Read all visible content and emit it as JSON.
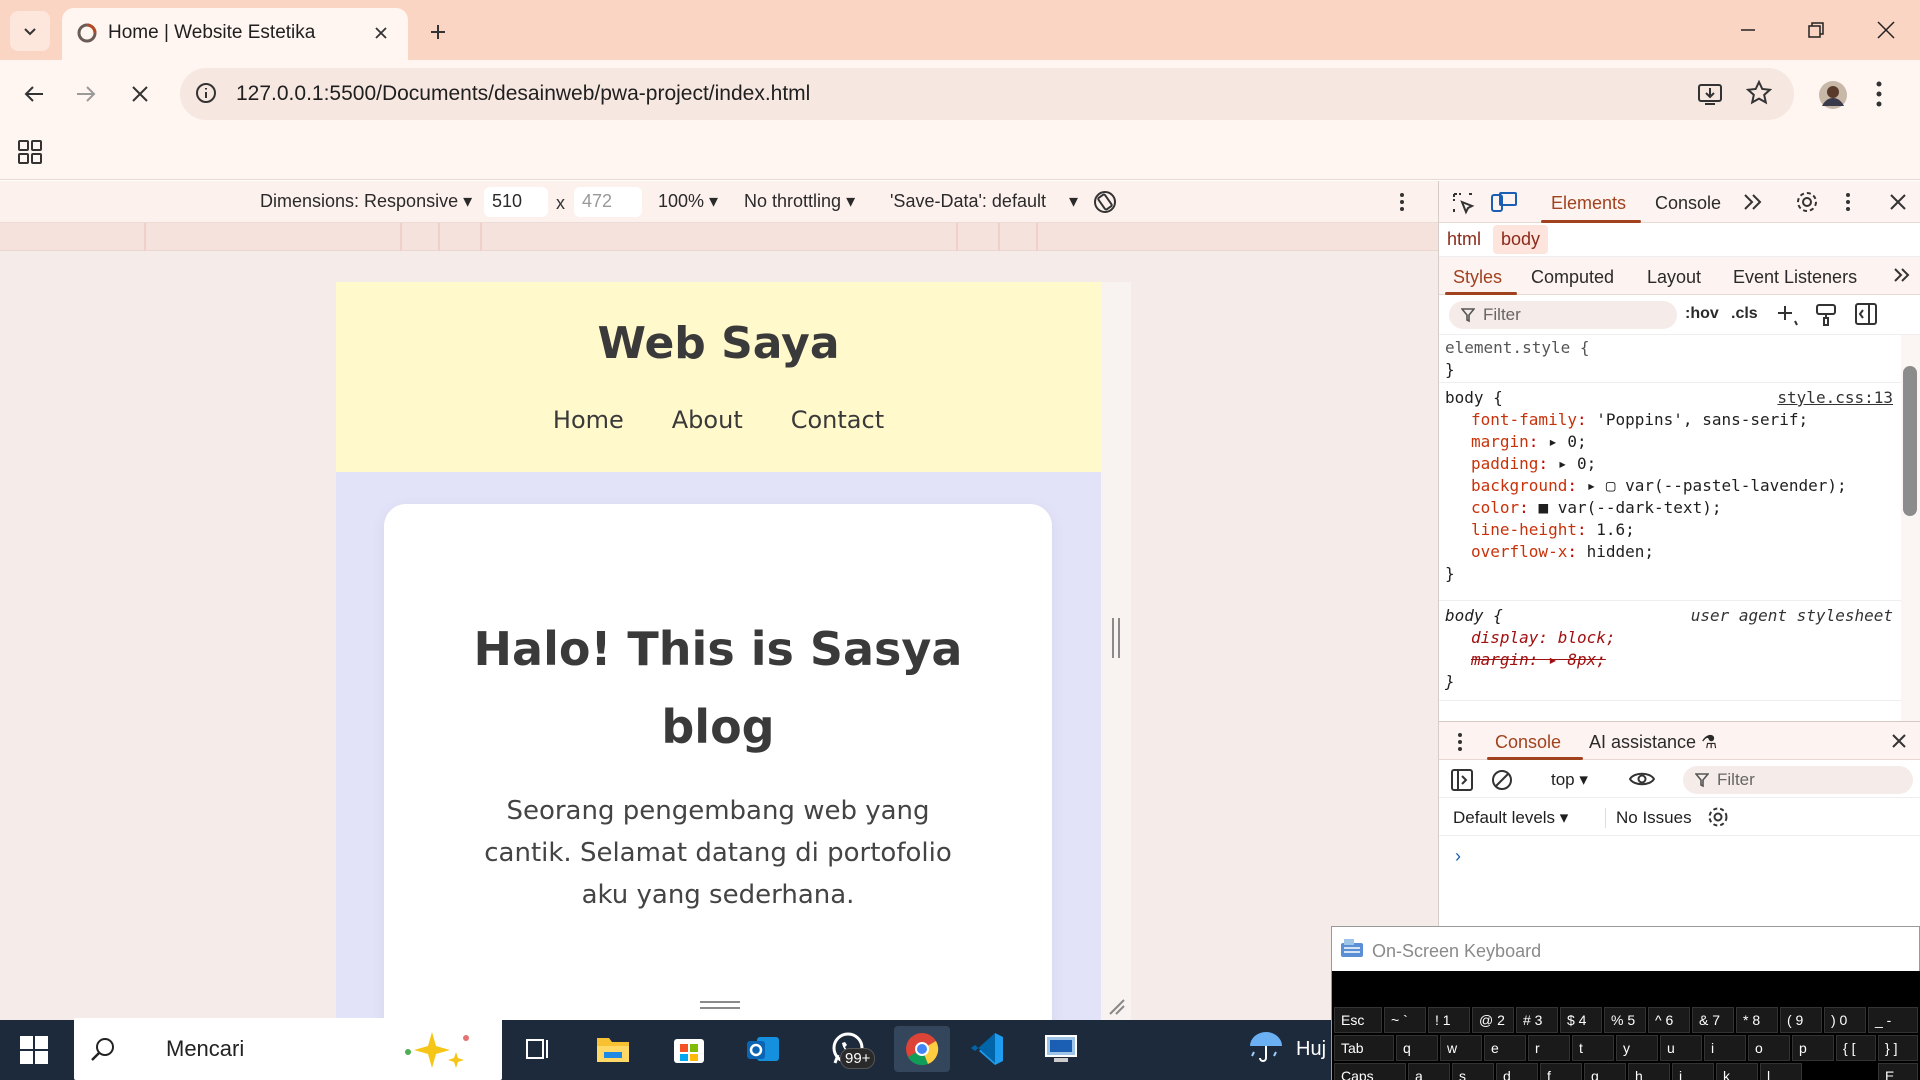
{
  "browser": {
    "tab_title": "Home | Website Estetika",
    "url": "127.0.0.1:5500/Documents/desainweb/pwa-project/index.html"
  },
  "device_toolbar": {
    "dimensions_label": "Dimensions: Responsive",
    "width_value": "510",
    "height_placeholder": "472",
    "times": "x",
    "zoom": "100%",
    "throttling": "No throttling",
    "save_data": "'Save-Data': default"
  },
  "site": {
    "title": "Web Saya",
    "nav": [
      "Home",
      "About",
      "Contact"
    ],
    "hero_title": "Halo! This is Sasya blog",
    "hero_text": "Seorang pengembang web yang cantik. Selamat datang di portofolio aku yang sederhana."
  },
  "devtools": {
    "tabs": {
      "elements": "Elements",
      "console": "Console"
    },
    "breadcrumb": {
      "html": "html",
      "body": "body"
    },
    "styles_tabs": [
      "Styles",
      "Computed",
      "Layout",
      "Event Listeners"
    ],
    "filter_placeholder": "Filter",
    "hov": ":hov",
    "cls": ".cls",
    "rules": {
      "element_style": "element.style {",
      "close": "}",
      "body_selector": "body {",
      "body_source": "style.css:13",
      "body_props": [
        {
          "name": "font-family",
          "value": "'Poppins', sans-serif;"
        },
        {
          "name": "margin",
          "value": "▸ 0;"
        },
        {
          "name": "padding",
          "value": "▸ 0;"
        },
        {
          "name": "background",
          "value": "▸ ▢ var(--pastel-lavender);"
        },
        {
          "name": "color",
          "value": "■ var(--dark-text);"
        },
        {
          "name": "line-height",
          "value": "1.6;"
        },
        {
          "name": "overflow-x",
          "value": "hidden;"
        }
      ],
      "ua_selector": "body {",
      "ua_source": "user agent stylesheet",
      "ua_display": "display: block;",
      "ua_margin": "margin: ▸ 8px;"
    },
    "console": {
      "tab": "Console",
      "ai_tab": "AI assistance",
      "context": "top",
      "filter_placeholder": "Filter",
      "levels": "Default levels",
      "issues": "No Issues",
      "prompt": "›"
    }
  },
  "osk": {
    "title": "On-Screen Keyboard",
    "row1": [
      "Esc",
      "~ `",
      "! 1",
      "@ 2",
      "# 3",
      "$ 4",
      "% 5",
      "^ 6",
      "& 7",
      "* 8",
      "( 9",
      ") 0",
      "_ -"
    ],
    "row2": [
      "Tab",
      "q",
      "w",
      "e",
      "r",
      "t",
      "y",
      "u",
      "i",
      "o",
      "p",
      "{ [",
      "} ]"
    ],
    "row3": [
      "Caps",
      "a",
      "s",
      "d",
      "f",
      "g",
      "h",
      "j",
      "k",
      "l",
      "E"
    ]
  },
  "taskbar": {
    "search_text": "Mencari",
    "whatsapp_badge": "99+",
    "weather": "Huj"
  }
}
